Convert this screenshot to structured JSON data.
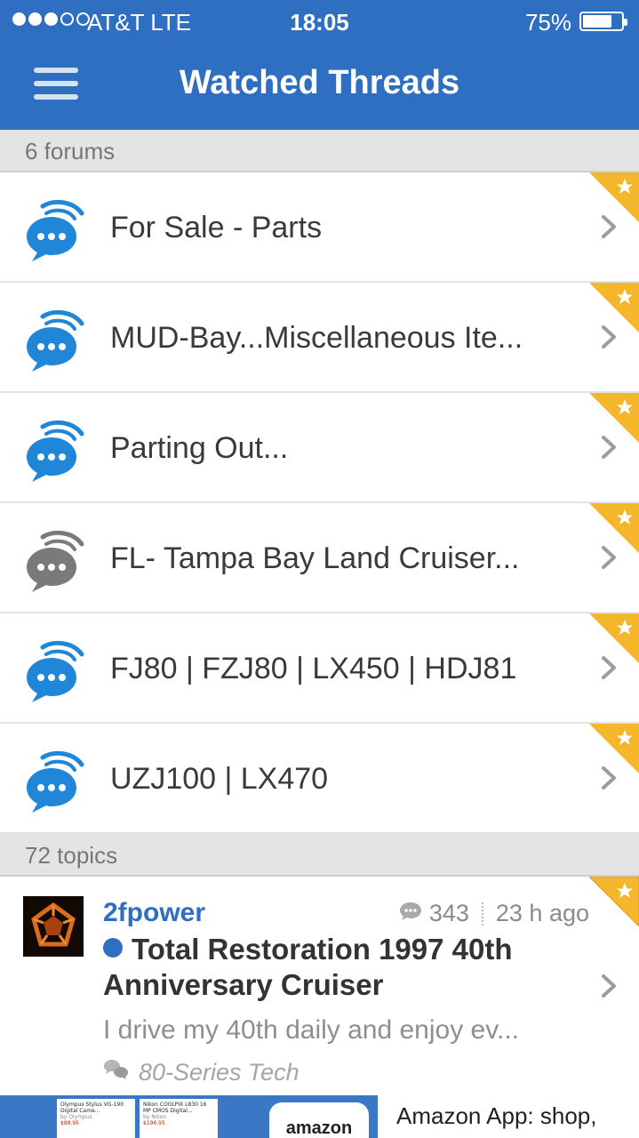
{
  "status_bar": {
    "carrier": "AT&T   LTE",
    "time": "18:05",
    "battery": "75%",
    "battery_level": 0.75
  },
  "header": {
    "title": "Watched Threads"
  },
  "forums_section": {
    "label": "6 forums",
    "items": [
      {
        "label": "For Sale - Parts",
        "icon": "chat-bubble-icon",
        "icon_color": "#1f86d8"
      },
      {
        "label": "MUD-Bay...Miscellaneous Ite...",
        "icon": "chat-bubble-icon",
        "icon_color": "#1f86d8"
      },
      {
        "label": "Parting Out...",
        "icon": "chat-bubble-icon",
        "icon_color": "#1f86d8"
      },
      {
        "label": "FL- Tampa Bay Land Cruiser...",
        "icon": "chat-bubble-icon",
        "icon_color": "#7a7a7a"
      },
      {
        "label": "FJ80 | FZJ80 | LX450 | HDJ81",
        "icon": "chat-bubble-icon",
        "icon_color": "#1f86d8"
      },
      {
        "label": "UZJ100 | LX470",
        "icon": "chat-bubble-icon",
        "icon_color": "#1f86d8"
      }
    ]
  },
  "topics_section": {
    "label": "72 topics",
    "items": [
      {
        "author": "2fpower",
        "replies": "343",
        "time_ago": "23 h ago",
        "title": "Total Restoration 1997 40th Anniversary Cruiser",
        "snippet": "I drive my 40th daily and enjoy ev...",
        "forum": "80-Series Tech"
      }
    ]
  },
  "ad": {
    "card1": {
      "title": "Olympus Stylus VG-190 Digital Came...",
      "by": "by Olympus",
      "price": "$89.95"
    },
    "card2": {
      "title": "Nikon COOLPIX L830 16 MP CMOS Digital...",
      "by": "by Nikon",
      "price": "$196.95"
    },
    "logo": "amazon",
    "text": "Amazon App: shop,"
  },
  "colors": {
    "brand_blue": "#2f6fc2",
    "star_gold": "#f4b62a",
    "unread_dot": "#2f6fc2"
  }
}
